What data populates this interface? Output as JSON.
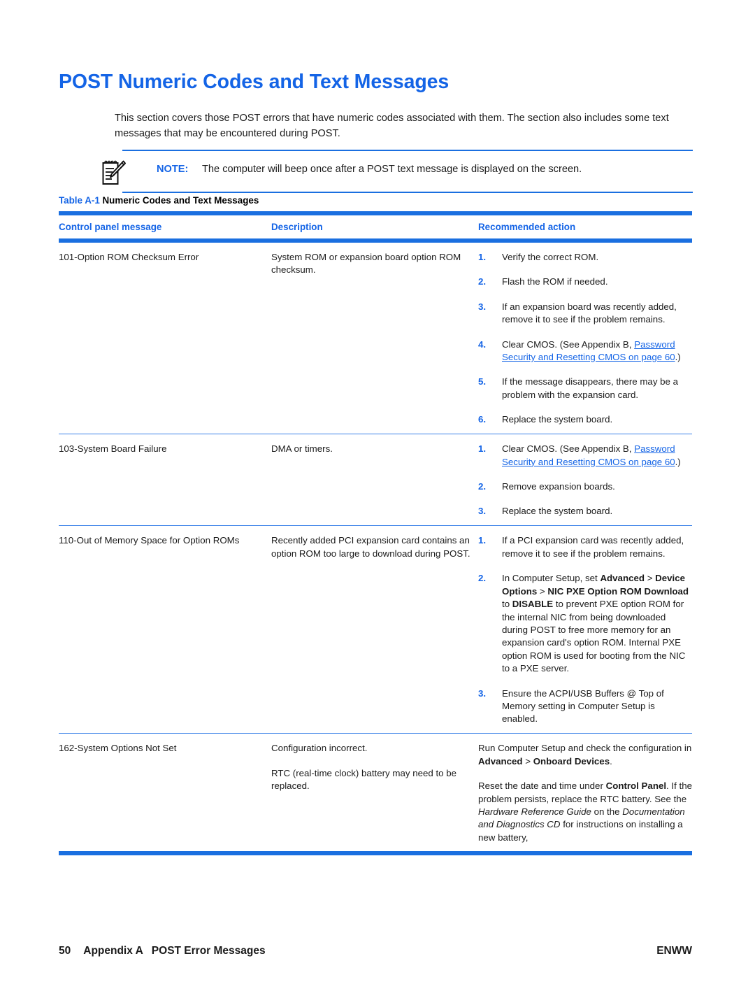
{
  "page": {
    "heading": "POST Numeric Codes and Text Messages",
    "intro": "This section covers those POST errors that have numeric codes associated with them. The section also includes some text messages that may be encountered during POST.",
    "accent_color": "#1464e6",
    "rule_color": "#1a6fe0",
    "link_color": "#1464e6"
  },
  "note": {
    "icon": "note-pencil-icon",
    "label": "NOTE:",
    "text": "The computer will beep once after a POST text message is displayed on the screen."
  },
  "table": {
    "caption_number": "Table A-1",
    "caption_title": "Numeric Codes and Text Messages",
    "columns": [
      "Control panel message",
      "Description",
      "Recommended action"
    ],
    "rows": [
      {
        "message": "101-Option ROM Checksum Error",
        "description_paragraphs": [
          "System ROM or expansion board option ROM checksum."
        ],
        "actions": [
          {
            "num": "1.",
            "text": "Verify the correct ROM."
          },
          {
            "num": "2.",
            "text": "Flash the ROM if needed."
          },
          {
            "num": "3.",
            "text": "If an expansion board was recently added, remove it to see if the problem remains."
          },
          {
            "num": "4.",
            "text": "Clear CMOS. (See Appendix B, ",
            "link": "Password Security and Resetting CMOS on page 60",
            "text_after": ".)"
          },
          {
            "num": "5.",
            "text": "If the message disappears, there may be a problem with the expansion card."
          },
          {
            "num": "6.",
            "text": "Replace the system board."
          }
        ]
      },
      {
        "message": "103-System Board Failure",
        "description_paragraphs": [
          "DMA or timers."
        ],
        "actions": [
          {
            "num": "1.",
            "text": "Clear CMOS. (See Appendix B, ",
            "link": "Password Security and Resetting CMOS on page 60",
            "text_after": ".)"
          },
          {
            "num": "2.",
            "text": "Remove expansion boards."
          },
          {
            "num": "3.",
            "text": "Replace the system board."
          }
        ]
      },
      {
        "message": "110-Out of Memory Space for Option ROMs",
        "description_paragraphs": [
          "Recently added PCI expansion card contains an option ROM too large to download during POST."
        ],
        "actions": [
          {
            "num": "1.",
            "text": "If a PCI expansion card was recently added, remove it to see if the problem remains."
          },
          {
            "num": "2.",
            "text": "In Computer Setup, set Advanced > Device Options > NIC PXE Option ROM Download to DISABLE to prevent PXE option ROM for the internal NIC from being downloaded during POST to free more memory for an expansion card's option ROM. Internal PXE option ROM is used for booting from the NIC to a PXE server.",
            "bold_terms": [
              "Advanced",
              "Device Options",
              "NIC PXE Option ROM Download",
              "DISABLE"
            ]
          },
          {
            "num": "3.",
            "text": "Ensure the ACPI/USB Buffers @ Top of Memory setting in Computer Setup is enabled."
          }
        ]
      },
      {
        "message": "162-System Options Not Set",
        "description_paragraphs": [
          "Configuration incorrect.",
          "RTC (real-time clock) battery may need to be replaced."
        ],
        "plain_actions": [
          {
            "text": "Run Computer Setup and check the configuration in Advanced > Onboard Devices.",
            "bold_terms": [
              "Advanced",
              "Onboard Devices"
            ]
          },
          {
            "text": "Reset the date and time under Control Panel. If the problem persists, replace the RTC battery. See the Hardware Reference Guide on the Documentation and Diagnostics CD for instructions on installing a new battery,",
            "bold_terms": [
              "Control Panel"
            ],
            "italic_terms": [
              "Hardware Reference Guide",
              "Documentation and Diagnostics CD"
            ]
          }
        ]
      }
    ]
  },
  "footer": {
    "page_number": "50",
    "appendix": "Appendix A",
    "section": "POST Error Messages",
    "locale": "ENWW"
  }
}
